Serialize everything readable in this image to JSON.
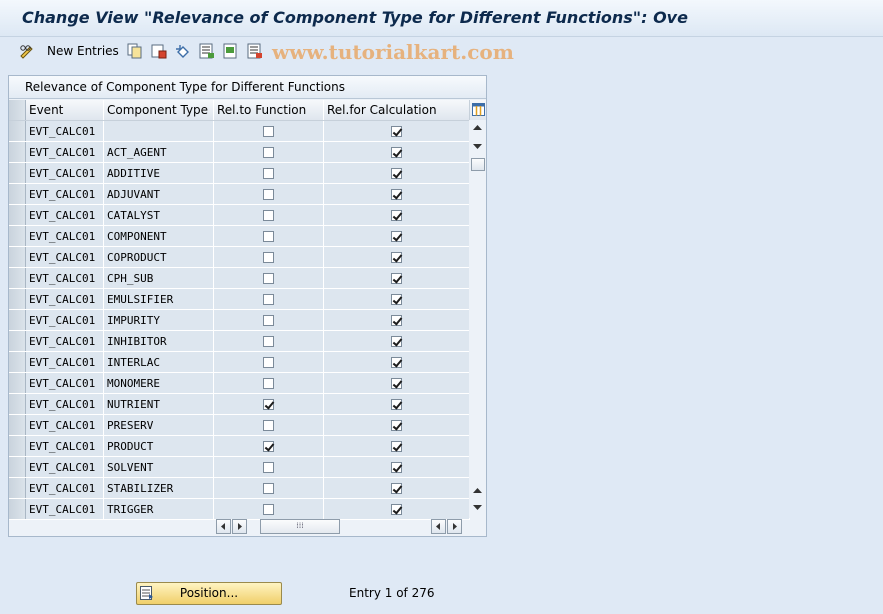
{
  "title": "Change View \"Relevance of Component Type for Different Functions\": Ove",
  "toolbar": {
    "new_entries": "New Entries"
  },
  "watermark": "www.tutorialkart.com",
  "panel": {
    "title": "Relevance of Component Type for Different Functions"
  },
  "columns": [
    "Event",
    "Component Type",
    "Rel.to Function",
    "Rel.for Calculation"
  ],
  "rows": [
    {
      "event": "EVT_CALC01",
      "type": "",
      "rel_function": false,
      "rel_calc": true
    },
    {
      "event": "EVT_CALC01",
      "type": "ACT_AGENT",
      "rel_function": false,
      "rel_calc": true
    },
    {
      "event": "EVT_CALC01",
      "type": "ADDITIVE",
      "rel_function": false,
      "rel_calc": true
    },
    {
      "event": "EVT_CALC01",
      "type": "ADJUVANT",
      "rel_function": false,
      "rel_calc": true
    },
    {
      "event": "EVT_CALC01",
      "type": "CATALYST",
      "rel_function": false,
      "rel_calc": true
    },
    {
      "event": "EVT_CALC01",
      "type": "COMPONENT",
      "rel_function": false,
      "rel_calc": true
    },
    {
      "event": "EVT_CALC01",
      "type": "COPRODUCT",
      "rel_function": false,
      "rel_calc": true
    },
    {
      "event": "EVT_CALC01",
      "type": "CPH_SUB",
      "rel_function": false,
      "rel_calc": true
    },
    {
      "event": "EVT_CALC01",
      "type": "EMULSIFIER",
      "rel_function": false,
      "rel_calc": true
    },
    {
      "event": "EVT_CALC01",
      "type": "IMPURITY",
      "rel_function": false,
      "rel_calc": true
    },
    {
      "event": "EVT_CALC01",
      "type": "INHIBITOR",
      "rel_function": false,
      "rel_calc": true
    },
    {
      "event": "EVT_CALC01",
      "type": "INTERLAC",
      "rel_function": false,
      "rel_calc": true
    },
    {
      "event": "EVT_CALC01",
      "type": "MONOMERE",
      "rel_function": false,
      "rel_calc": true
    },
    {
      "event": "EVT_CALC01",
      "type": "NUTRIENT",
      "rel_function": true,
      "rel_calc": true
    },
    {
      "event": "EVT_CALC01",
      "type": "PRESERV",
      "rel_function": false,
      "rel_calc": true
    },
    {
      "event": "EVT_CALC01",
      "type": "PRODUCT",
      "rel_function": true,
      "rel_calc": true
    },
    {
      "event": "EVT_CALC01",
      "type": "SOLVENT",
      "rel_function": false,
      "rel_calc": true
    },
    {
      "event": "EVT_CALC01",
      "type": "STABILIZER",
      "rel_function": false,
      "rel_calc": true
    },
    {
      "event": "EVT_CALC01",
      "type": "TRIGGER",
      "rel_function": false,
      "rel_calc": true
    }
  ],
  "footer": {
    "position_button": "Position...",
    "entry_text": "Entry 1 of 276"
  },
  "icons": [
    "pencil-glasses-icon",
    "copy-icon",
    "save-variant-icon",
    "undo-icon",
    "select-all-icon",
    "select-block-icon",
    "deselect-all-icon",
    "column-config-icon",
    "position-icon"
  ]
}
